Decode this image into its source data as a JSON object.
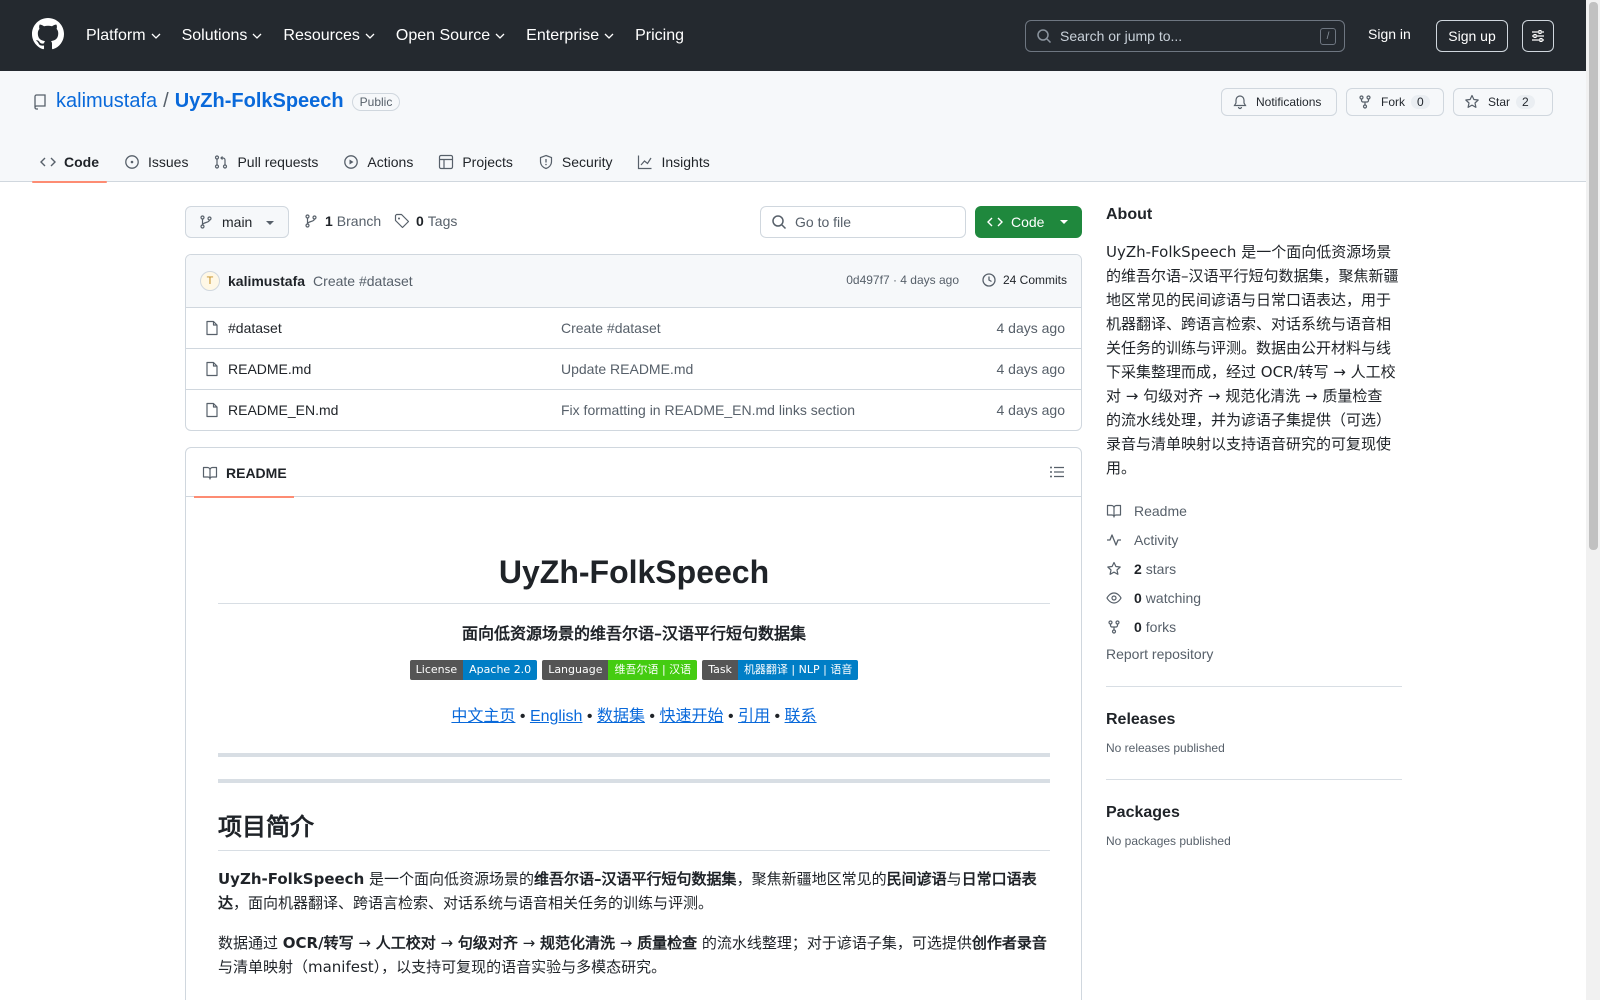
{
  "nav": {
    "items": [
      "Platform",
      "Solutions",
      "Resources",
      "Open Source",
      "Enterprise",
      "Pricing"
    ],
    "search_placeholder": "Search or jump to...",
    "slash_hint": "/",
    "sign_in": "Sign in",
    "sign_up": "Sign up"
  },
  "repo": {
    "owner": "kalimustafa",
    "separator": "/",
    "name": "UyZh-FolkSpeech",
    "visibility": "Public",
    "notifications_label": "Notifications",
    "fork_label": "Fork",
    "fork_count": "0",
    "star_label": "Star",
    "star_count": "2"
  },
  "tabs": [
    "Code",
    "Issues",
    "Pull requests",
    "Actions",
    "Projects",
    "Security",
    "Insights"
  ],
  "toolbar": {
    "branch": "main",
    "branch_count": "1",
    "branch_label": "Branch",
    "tag_count": "0",
    "tag_label": "Tags",
    "goto_placeholder": "Go to file",
    "code_label": "Code"
  },
  "commit": {
    "avatar_initial": "T",
    "author": "kalimustafa",
    "message": "Create #dataset",
    "meta": "0d497f7 · 4 days ago",
    "count_label": "24 Commits"
  },
  "files": [
    {
      "name": "#dataset",
      "message": "Create #dataset",
      "date": "4 days ago"
    },
    {
      "name": "README.md",
      "message": "Update README.md",
      "date": "4 days ago"
    },
    {
      "name": "README_EN.md",
      "message": "Fix formatting in README_EN.md links section",
      "date": "4 days ago"
    }
  ],
  "readme": {
    "tab_label": "README",
    "title": "UyZh-FolkSpeech",
    "subtitle": "面向低资源场景的维吾尔语–汉语平行短句数据集",
    "badges": [
      {
        "left": "License",
        "right": "Apache 2.0",
        "color": "#007ec6"
      },
      {
        "left": "Language",
        "right": "维吾尔语 | 汉语",
        "color": "#4c1"
      },
      {
        "left": "Task",
        "right": "机器翻译 | NLP | 语音",
        "color": "#007ec6"
      }
    ],
    "links": [
      "中文主页",
      "English",
      "数据集",
      "快速开始",
      "引用",
      "联系"
    ],
    "link_separator": "•",
    "section_title": "项目简介",
    "p1": {
      "s1": "UyZh-FolkSpeech",
      "t1": " 是一个面向低资源场景的",
      "s2": "维吾尔语–汉语平行短句数据集",
      "t2": "，聚焦新疆地区常见的",
      "s3": "民间谚语",
      "t3": "与",
      "s4": "日常口语表达",
      "t4": "，面向机器翻译、跨语言检索、对话系统与语音相关任务的训练与评测。"
    },
    "p2": {
      "t1": "数据通过 ",
      "s1": "OCR/转写",
      "a1": " → ",
      "s2": "人工校对",
      "a2": " → ",
      "s3": "句级对齐",
      "a3": " → ",
      "s4": "规范化清洗",
      "a4": " → ",
      "s5": "质量检查",
      "t2": " 的流水线整理；对于谚语子集，可选提供",
      "s6": "创作者录音",
      "t3": "与清单映射（manifest），以支持可复现的语音实验与多模态研究。"
    }
  },
  "sidebar": {
    "about_title": "About",
    "about_text": "UyZh-FolkSpeech 是一个面向低资源场景的维吾尔语–汉语平行短句数据集，聚焦新疆地区常见的民间谚语与日常口语表达，用于机器翻译、跨语言检索、对话系统与语音相关任务的训练与评测。数据由公开材料与线下采集整理而成，经过 OCR/转写 → 人工校对 → 句级对齐 → 规范化清洗 → 质量检查 的流水线处理，并为谚语子集提供（可选）录音与清单映射以支持语音研究的可复现使用。",
    "readme": "Readme",
    "activity": "Activity",
    "stars_count": "2",
    "stars_label": "stars",
    "watching_count": "0",
    "watching_label": "watching",
    "forks_count": "0",
    "forks_label": "forks",
    "report": "Report repository",
    "releases_title": "Releases",
    "releases_text": "No releases published",
    "packages_title": "Packages",
    "packages_text": "No packages published"
  }
}
